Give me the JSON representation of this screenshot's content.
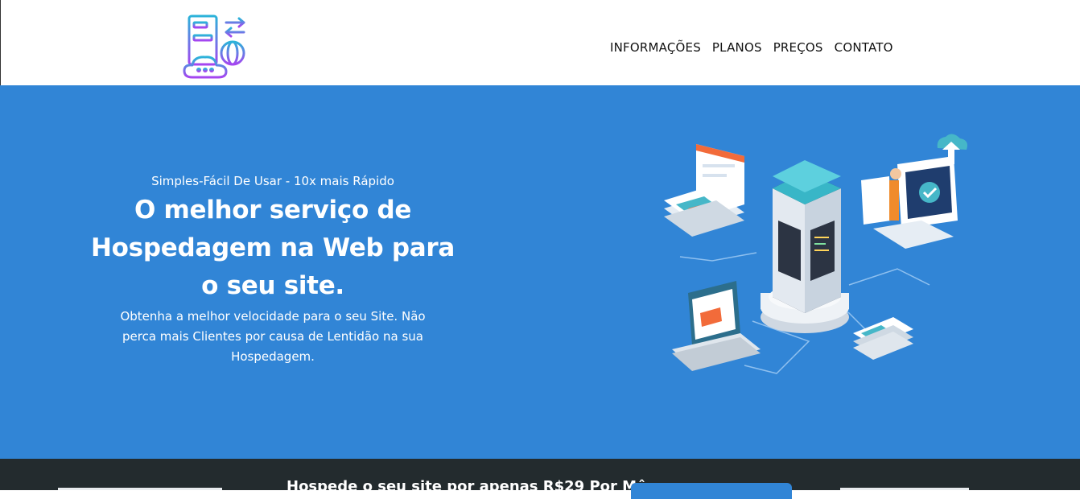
{
  "header": {
    "logo_icon": "server-cloud-globe-icon",
    "nav": [
      {
        "label": "INFORMAÇÕES"
      },
      {
        "label": "PLANOS"
      },
      {
        "label": "PREÇOS"
      },
      {
        "label": "CONTATO"
      }
    ]
  },
  "hero": {
    "tagline": "Simples-Fácil De Usar - 10x mais Rápido",
    "headline": "O melhor serviço de Hospedagem na Web para o seu site.",
    "description": "Obtenha a melhor velocidade para o seu Site. Não perca mais Clientes por causa de Lentidão na sua Hospedagem.",
    "illustration_icon": "isometric-server-network-illustration",
    "background_color": "#3185d6"
  },
  "promo": {
    "text": "Hospede o seu site por apenas R$29 Por Mês",
    "background_color": "#232b2e"
  }
}
